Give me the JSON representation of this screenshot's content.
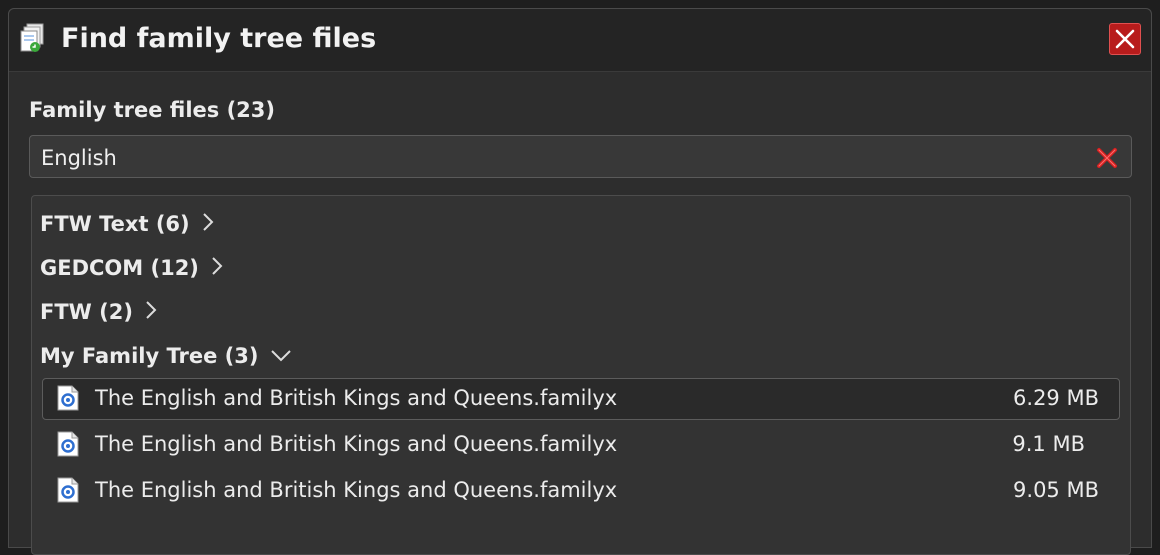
{
  "window": {
    "title": "Find family tree files",
    "app_icon": "documents-icon",
    "close_icon": "close-icon"
  },
  "files_section": {
    "label": "Family tree files (23)"
  },
  "search": {
    "value": "English",
    "clear_icon": "clear-icon"
  },
  "groups": [
    {
      "label": "FTW Text (6)",
      "expanded": false
    },
    {
      "label": "GEDCOM (12)",
      "expanded": false
    },
    {
      "label": "FTW (2)",
      "expanded": false
    },
    {
      "label": "My Family Tree (3)",
      "expanded": true
    }
  ],
  "files": [
    {
      "name": "The English and British Kings and Queens.familyx",
      "size": "6.29 MB",
      "selected": true
    },
    {
      "name": "The English and British Kings and Queens.familyx",
      "size": "9.1 MB",
      "selected": false
    },
    {
      "name": "The English and British Kings and Queens.familyx",
      "size": "9.05 MB",
      "selected": false
    }
  ],
  "colors": {
    "background": "#2d2d2d",
    "close_button": "#b81c1c",
    "clear_icon": "#d42020",
    "file_icon_accent": "#2f6fd0"
  }
}
